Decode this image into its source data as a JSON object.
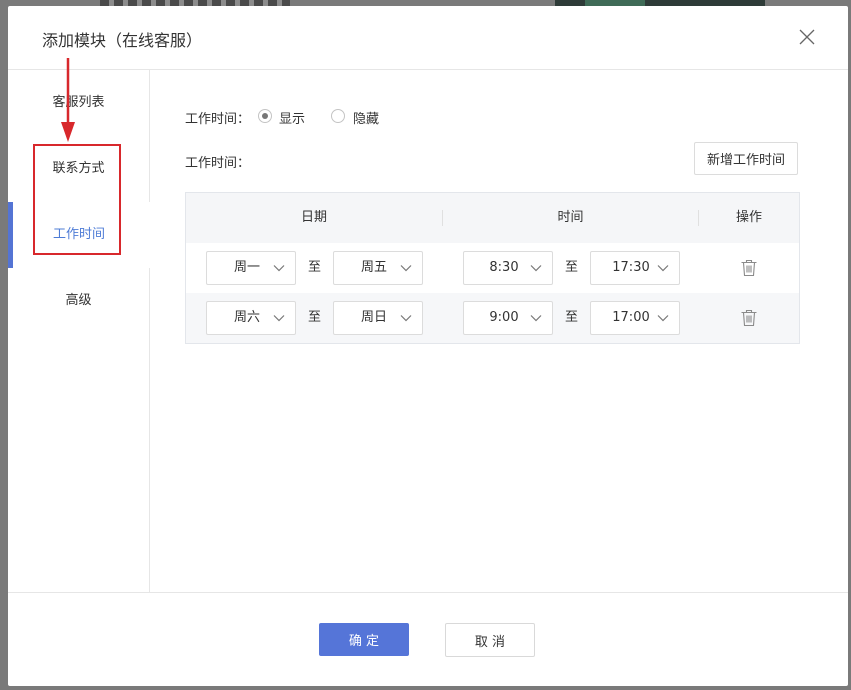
{
  "modal": {
    "title": "添加模块（在线客服）"
  },
  "sidebar": {
    "items": [
      {
        "label": "客服列表"
      },
      {
        "label": "联系方式"
      },
      {
        "label": "工作时间",
        "active": true
      },
      {
        "label": "高级"
      }
    ]
  },
  "form": {
    "display_label": "工作时间：",
    "display_options": [
      {
        "label": "显示",
        "checked": true
      },
      {
        "label": "隐藏",
        "checked": false
      }
    ],
    "list_label": "工作时间：",
    "add_button": "新增工作时间"
  },
  "table": {
    "headers": [
      "日期",
      "时间",
      "操作"
    ],
    "rows": [
      {
        "day_from": "周一",
        "day_to": "周五",
        "time_from": "8:30",
        "time_to": "17:30"
      },
      {
        "day_from": "周六",
        "day_to": "周日",
        "time_from": "9:00",
        "time_to": "17:00"
      }
    ],
    "range_separator": "至"
  },
  "footer": {
    "ok_label": "确 定",
    "cancel_label": "取 消"
  },
  "colors": {
    "primary": "#5575d8",
    "active_text": "#4e7cd6",
    "annotation": "#d8282c"
  }
}
